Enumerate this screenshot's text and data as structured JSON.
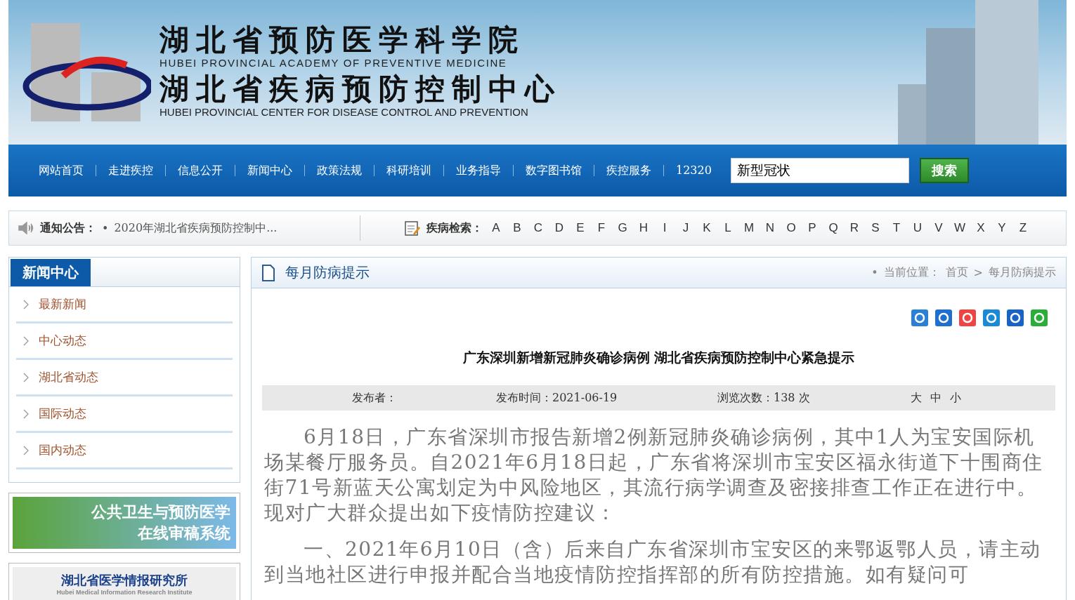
{
  "header": {
    "title_cn": "湖北省预防医学科学院",
    "title_en": "HUBEI PROVINCIAL ACADEMY OF PREVENTIVE MEDICINE",
    "subtitle_cn": "湖北省疾病预防控制中心",
    "subtitle_en": "HUBEI PROVINCIAL CENTER FOR DISEASE CONTROL AND PREVENTION"
  },
  "nav": {
    "items": [
      "网站首页",
      "走进疾控",
      "信息公开",
      "新闻中心",
      "政策法规",
      "科研培训",
      "业务指导",
      "数字图书馆",
      "疾控服务",
      "12320"
    ],
    "search": {
      "value": "新型冠状",
      "button": "搜索"
    }
  },
  "notice": {
    "label": "通知公告：",
    "bullet": "•",
    "text": "2020年湖北省疾病预防控制中..."
  },
  "disease_search": {
    "label": "疾病检索：",
    "letters": [
      "A",
      "B",
      "C",
      "D",
      "E",
      "F",
      "G",
      "H",
      "I",
      "J",
      "K",
      "L",
      "M",
      "N",
      "O",
      "P",
      "Q",
      "R",
      "S",
      "T",
      "U",
      "V",
      "W",
      "X",
      "Y",
      "Z"
    ]
  },
  "sidebar": {
    "title": "新闻中心",
    "items": [
      "最新新闻",
      "中心动态",
      "湖北省动态",
      "国际动态",
      "国内动态"
    ]
  },
  "banners": [
    {
      "lines": [
        "公共卫生与预防医学",
        "在线审稿系统"
      ]
    },
    {
      "lines": [
        "湖北省医学情报研究所",
        "Hubei Medical Information Research Institute"
      ]
    }
  ],
  "article": {
    "section": "每月防病提示",
    "breadcrumb": {
      "bullet": "•",
      "prefix": "当前位置：",
      "separator": ">",
      "items": [
        "首页",
        "每月防病提示"
      ]
    },
    "title": "广东深圳新增新冠肺炎确诊病例 湖北省疾病预防控制中心紧急提示",
    "meta": {
      "publisher": "发布者：",
      "date": "发布时间：2021-06-19",
      "views": "浏览次数：138 次",
      "sizes": [
        "大",
        "中",
        "小"
      ]
    },
    "paragraphs": [
      "6月18日，广东省深圳市报告新增2例新冠肺炎确诊病例，其中1人为宝安国际机场某餐厅服务员。自2021年6月18日起，广东省将深圳市宝安区福永街道下十围商住街71号新蓝天公寓划定为中风险地区，其流行病学调查及密接排查工作正在进行中。现对广大群众提出如下疫情防控建议：",
      "一、2021年6月10日（含）后来自广东省深圳市宝安区的来鄂返鄂人员，请主动到当地社区进行申报并配合当地疫情防控指挥部的所有防控措施。如有疑问可"
    ]
  }
}
